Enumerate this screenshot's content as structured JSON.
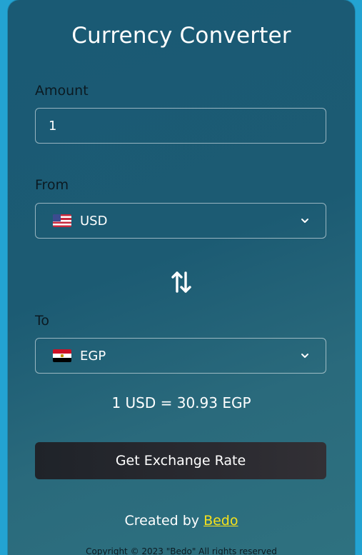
{
  "app": {
    "title": "Currency Converter"
  },
  "amount": {
    "label": "Amount",
    "value": "1"
  },
  "from": {
    "label": "From",
    "currency": "USD",
    "flag": "us-flag-icon"
  },
  "to": {
    "label": "To",
    "currency": "EGP",
    "flag": "egypt-flag-icon"
  },
  "swap": {
    "icon": "swap-arrows-icon"
  },
  "result": {
    "text": "1 USD = 30.93 EGP"
  },
  "button": {
    "label": "Get Exchange Rate"
  },
  "footer": {
    "created_prefix": "Created by ",
    "author": "Bedo",
    "copyright": "Copyright © 2023 \"Bedo\" All rights reserved"
  },
  "colors": {
    "page_background": "#23a3d2",
    "card_background": "#1c5b73",
    "button_background": "#2a2a30",
    "link_color": "#f5e11c"
  }
}
